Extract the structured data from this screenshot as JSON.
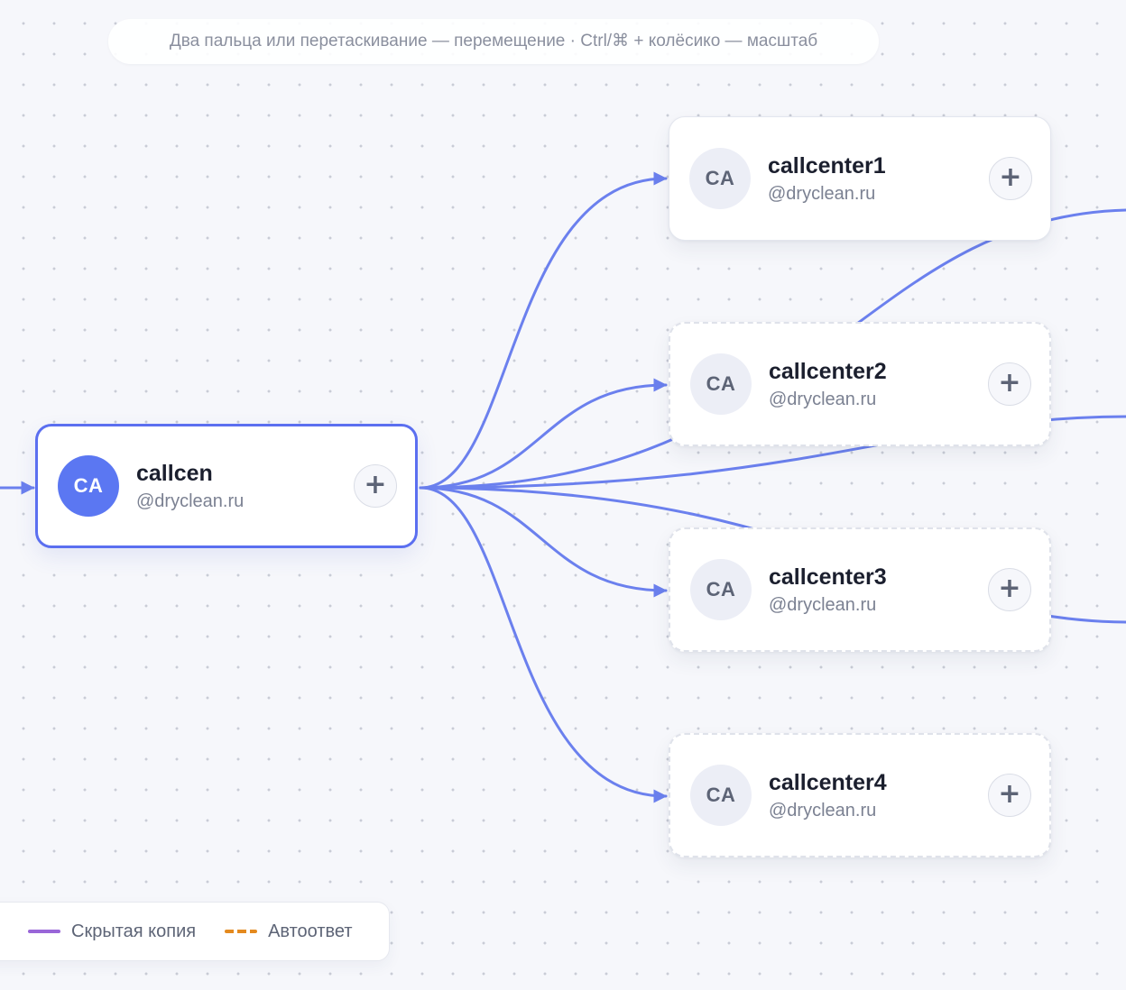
{
  "hint": {
    "text": "Два пальца или перетаскивание — перемещение · Ctrl/⌘ + колёсико — масштаб"
  },
  "nodes": [
    {
      "id": "callcen",
      "initials": "CA",
      "name": "callcen",
      "domain": "@dryclean.ru",
      "selected": true
    },
    {
      "id": "callcenter1",
      "initials": "CA",
      "name": "callcenter1",
      "domain": "@dryclean.ru"
    },
    {
      "id": "callcenter2",
      "initials": "CA",
      "name": "callcenter2",
      "domain": "@dryclean.ru"
    },
    {
      "id": "callcenter3",
      "initials": "CA",
      "name": "callcenter3",
      "domain": "@dryclean.ru"
    },
    {
      "id": "callcenter4",
      "initials": "CA",
      "name": "callcenter4",
      "domain": "@dryclean.ru"
    }
  ],
  "add_symbol": "+",
  "legend": {
    "bcc_label": "Скрытая копия",
    "autoreply_label": "Автоответ"
  },
  "colors": {
    "edge": "#6b80ee",
    "bcc": "#9966d8",
    "autoreply": "#e48a1f",
    "accent": "#5b77f2"
  }
}
